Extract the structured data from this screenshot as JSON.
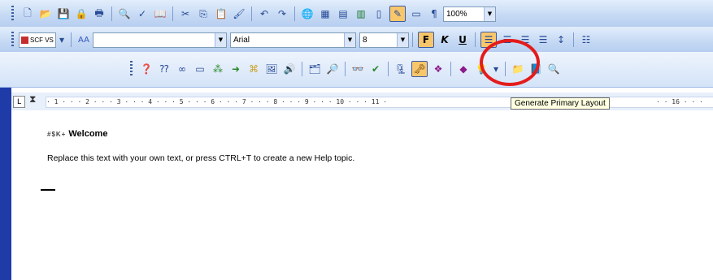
{
  "toolbar1": {
    "zoom": "100%"
  },
  "toolbar2": {
    "scf_label": "SCF VS",
    "style_icon": "AA",
    "font_name": "Arial",
    "font_size": "8",
    "bold_label": "F",
    "italic_label": "K",
    "underline_label": "U"
  },
  "ruler": {
    "tab_selector": "L",
    "ticks": "· 1 · · · 2 · · · 3 · · · 4 · · · 5 · · · 6 · · · 7 · · · 8 · · · 9 · · · 10 · · · 11 ·",
    "tick_16": "· · 16 · · ·"
  },
  "document": {
    "heading_marks": "#$K+",
    "heading": "Welcome",
    "body": "Replace this text with your own text, or press CTRL+T to create a new Help topic."
  },
  "tooltip": {
    "text": "Generate Primary Layout"
  },
  "colors": {
    "toolbar_bg": "#c5d9f4",
    "highlight_circle": "#e41b1b",
    "tooltip_bg": "#ffffe1",
    "left_bar": "#1f3ba8"
  }
}
